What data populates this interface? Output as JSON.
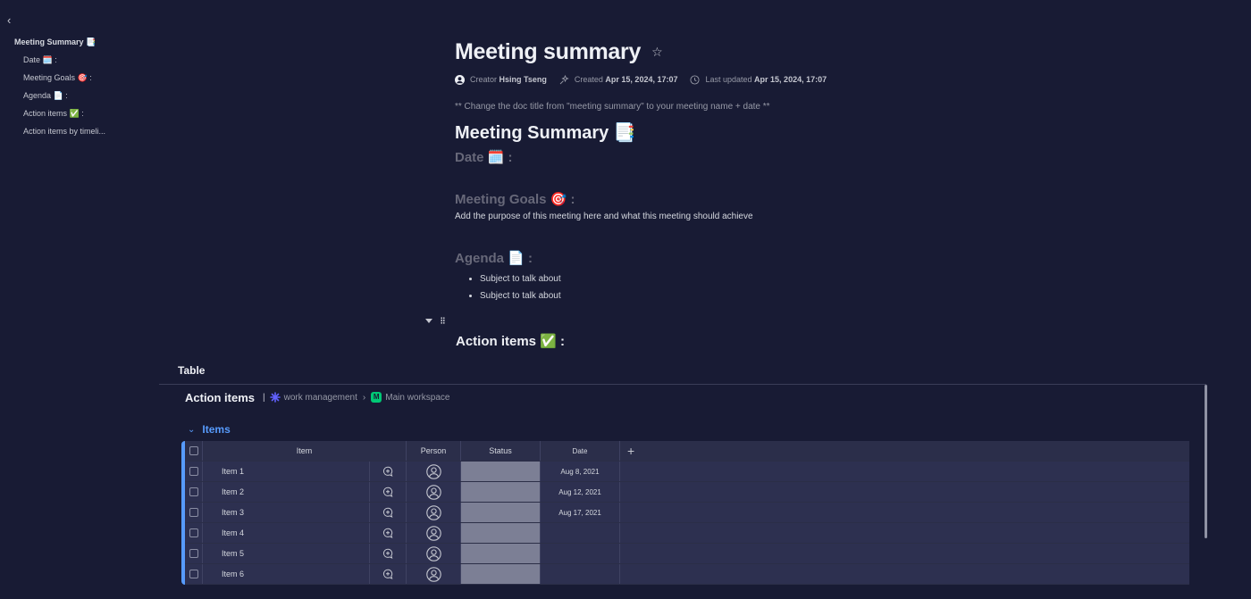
{
  "outline": {
    "items": [
      {
        "label": "Meeting Summary 📑",
        "level": "top"
      },
      {
        "label": "Date 🗓️ :",
        "level": "sub"
      },
      {
        "label": "Meeting Goals 🎯 :",
        "level": "sub"
      },
      {
        "label": "Agenda 📄 :",
        "level": "sub"
      },
      {
        "label": "Action items ✅ :",
        "level": "sub"
      },
      {
        "label": "Action items by timeli...",
        "level": "sub"
      }
    ]
  },
  "doc": {
    "title": "Meeting summary",
    "meta": {
      "creator_label": "Creator",
      "creator_name": "Hsing Tseng",
      "created_label": "Created",
      "created_value": "Apr 15, 2024, 17:07",
      "updated_label": "Last updated",
      "updated_value": "Apr 15, 2024, 17:07"
    },
    "note": "** Change the doc title from \"meeting summary\" to your meeting name + date **",
    "heading": "Meeting Summary 📑",
    "date_heading": "Date 🗓️ :",
    "goals_heading": "Meeting Goals 🎯 :",
    "goals_text": "Add the purpose of this meeting here and what this meeting should achieve",
    "agenda_heading": "Agenda 📄 :",
    "agenda_items": [
      "Subject to talk about",
      "Subject to talk about"
    ],
    "action_heading": "Action items ✅ :"
  },
  "widget": {
    "label": "Table",
    "board_title": "Action items",
    "crumb_separator": "|",
    "crumb_product": "work management",
    "crumb_workspace_badge": "M",
    "crumb_workspace": "Main workspace",
    "group_title": "Items",
    "columns": {
      "item": "Item",
      "person": "Person",
      "status": "Status",
      "date": "Date",
      "add": "+"
    },
    "rows": [
      {
        "name": "Item 1",
        "date": "Aug 8, 2021"
      },
      {
        "name": "Item 2",
        "date": "Aug 12, 2021"
      },
      {
        "name": "Item 3",
        "date": "Aug 17, 2021"
      },
      {
        "name": "Item 4",
        "date": ""
      },
      {
        "name": "Item 5",
        "date": ""
      },
      {
        "name": "Item 6",
        "date": ""
      }
    ]
  },
  "icons": {
    "back": "chevron-left-icon",
    "favorite": "star-icon",
    "creator": "user-icon",
    "created": "sparkle-icon",
    "updated": "clock-icon",
    "updates": "add-update-icon",
    "person": "person-avatar-icon"
  },
  "colors": {
    "background": "#181b34",
    "group_accent": "#579bfc",
    "status_empty": "#7c7f95",
    "workspace_badge": "#00c875"
  }
}
